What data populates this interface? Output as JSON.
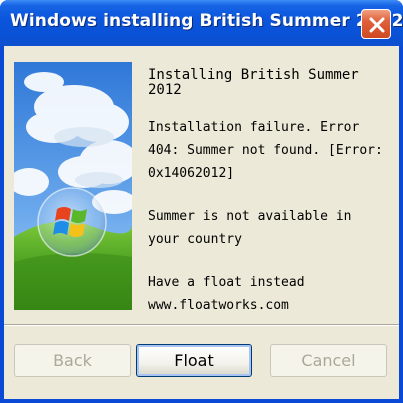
{
  "window": {
    "title": "Windows installing British Summer 2012"
  },
  "message": {
    "heading": "Installing British Summer 2012",
    "error": "Installation failure. Error 404: Summer not found. [Error: 0x14062012]",
    "unavailable": "Summer is not available in your country",
    "suggestion": "Have a float instead www.floatworks.com"
  },
  "buttons": {
    "back": "Back",
    "float": "Float",
    "cancel": "Cancel"
  },
  "colors": {
    "titlebar": "#0a52d8",
    "dialog_bg": "#ece9d8",
    "close_button": "#d9572f",
    "disabled_text": "#aca899"
  },
  "icons": {
    "close": "close-icon",
    "windows_logo": "windows-logo-icon"
  }
}
